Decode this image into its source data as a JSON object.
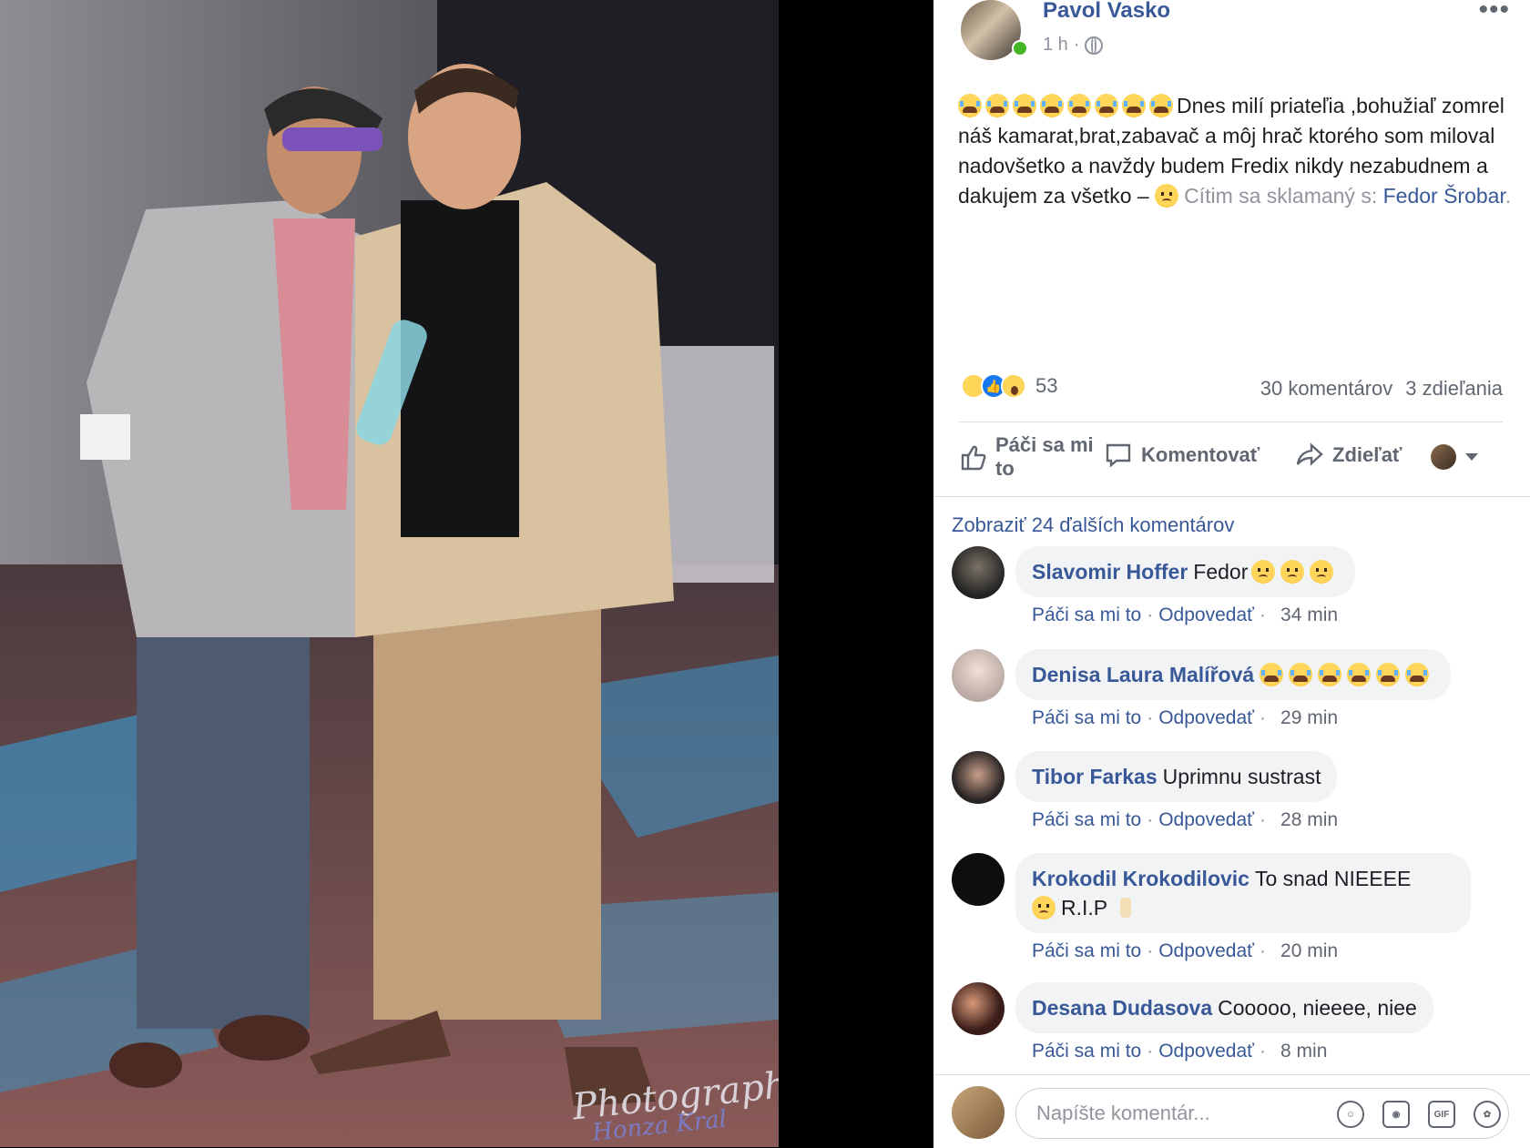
{
  "photo": {
    "watermark_line1": "Photography",
    "watermark_line2": "Honza Kral"
  },
  "post": {
    "author": "Pavol Vasko",
    "time": "1 h",
    "privacy_icon": "globe-icon",
    "more_icon": "more-dots-icon",
    "text_main": "Dnes milí priateľia ,bohužiaľ zomrel náš kamarat,brat,zabavač a môj hrač ktorého som miloval nadovšetko a navždy budem Fredix nikdy nezabudnem a dakujem za všetko –",
    "feeling": "Cítim sa sklamaný",
    "with_prefix": "s:",
    "tagged": "Fedor Šrobar",
    "tag_end": ".",
    "crying_emoji_count": 8
  },
  "reactions": {
    "types": [
      "sad",
      "like",
      "wow"
    ],
    "count": "53",
    "comments": "30 komentárov",
    "shares": "3 zdieľania"
  },
  "actions": {
    "like": "Páči sa mi to",
    "comment": "Komentovať",
    "share": "Zdieľať"
  },
  "more_comments": "Zobraziť 24 ďalších komentárov",
  "comments": [
    {
      "name": "Slavomir Hoffer",
      "text": "Fedor",
      "emoji_sad": 3,
      "like": "Páči sa mi to",
      "reply": "Odpovedať",
      "time": "34 min"
    },
    {
      "name": "Denisa Laura Malířová",
      "text": "",
      "emoji_cry": 6,
      "like": "Páči sa mi to",
      "reply": "Odpovedať",
      "time": "29 min"
    },
    {
      "name": "Tibor Farkas",
      "text": "Uprimnu sustrast",
      "like": "Páči sa mi to",
      "reply": "Odpovedať",
      "time": "28 min"
    },
    {
      "name": "Krokodil Krokodilovic",
      "text": "To snad NIEEEE",
      "text2": "R.I.P",
      "like": "Páči sa mi to",
      "reply": "Odpovedať",
      "time": "20 min"
    },
    {
      "name": "Desana Dudasova",
      "text": "Cooooo, nieeee, niee",
      "like": "Páči sa mi to",
      "reply": "Odpovedať",
      "time": "8 min"
    }
  ],
  "composer": {
    "placeholder": "Napíšte komentár...",
    "icons": [
      "emoji-icon",
      "camera-icon",
      "gif-icon",
      "sticker-icon"
    ],
    "gif_label": "GIF"
  }
}
